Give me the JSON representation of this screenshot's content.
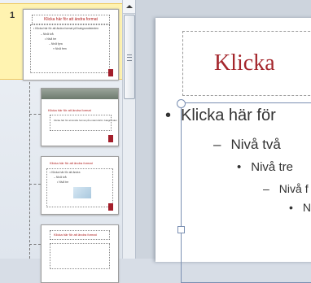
{
  "thumbnails": {
    "master": {
      "slide_number": "1",
      "title": "Klicka här för att ändra format",
      "body_lines": [
        "• Klicka här för att ändra format på bakgrundstexten",
        "– Nivå två",
        "• Nivå tre",
        "– Nivå fyra",
        "» Nivå fem"
      ]
    },
    "layouts": [
      {
        "title": "Klicka här för att ändra format",
        "subtitle": "Klicka här för att ändra format på underrubrik i bakgrunden"
      },
      {
        "title": "Klicka här för att ändra format",
        "body_lines": [
          "• Klicka här för att ändra",
          "– Nivå två",
          "• Nivå tre"
        ]
      },
      {
        "title": "Klicka här för att ändra format"
      }
    ]
  },
  "slide": {
    "title": "Klicka",
    "levels": {
      "level1": "Klicka här för",
      "level2": "Nivå två",
      "level3": "Nivå tre",
      "level4": "Nivå f",
      "level5": "N"
    },
    "bullets": {
      "level1": "•",
      "level2": "–",
      "level3": "•",
      "level4": "–",
      "level5": "•"
    }
  },
  "icons": [
    "scroll-up-arrow-icon",
    "scroll-grip-icon"
  ],
  "colors": {
    "title": "#a4262c",
    "selection": "#fff3b0",
    "accent_logo": "#a31e2a"
  }
}
